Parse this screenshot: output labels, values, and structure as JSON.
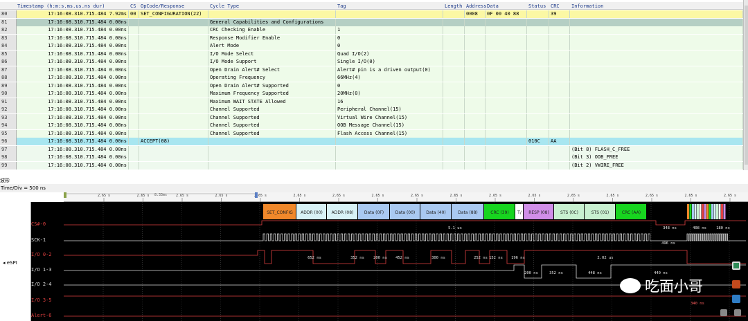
{
  "table": {
    "columns": [
      "Timestamp (h:m:s.ms.us.ns dur)",
      "CS",
      "OpCode/Response",
      "Cycle Type",
      "Tag",
      "Length",
      "Address",
      "Data",
      "Status",
      "CRC",
      "Information"
    ],
    "rows": [
      {
        "idx": "80",
        "ts": "17:16:08.310.715.484 7.92ms",
        "cs": "00",
        "op": "SET_CONFIGURATION(22)",
        "cycle": "",
        "tag": "",
        "len": "",
        "addr": "0008",
        "data": "0F 00 40 88",
        "status": "",
        "crc": "39",
        "info": "",
        "style": "y"
      },
      {
        "idx": "81",
        "ts": "17:16:08.310.715.484 0.00ns",
        "cs": "",
        "op": "",
        "cycle": "General Capabilities and Configurations",
        "tag": "",
        "len": "",
        "addr": "",
        "data": "",
        "status": "",
        "crc": "",
        "info": "",
        "style": "g"
      },
      {
        "idx": "82",
        "ts": "17:16:08.310.715.484 0.00ns",
        "cs": "",
        "op": "",
        "cycle": "CRC Checking Enable",
        "tag": "1",
        "len": "",
        "addr": "",
        "data": "",
        "status": "",
        "crc": "",
        "info": "",
        "style": ""
      },
      {
        "idx": "83",
        "ts": "17:16:08.310.715.484 0.00ns",
        "cs": "",
        "op": "",
        "cycle": "Response Modifier Enable",
        "tag": "0",
        "len": "",
        "addr": "",
        "data": "",
        "status": "",
        "crc": "",
        "info": "",
        "style": ""
      },
      {
        "idx": "84",
        "ts": "17:16:08.310.715.484 0.00ns",
        "cs": "",
        "op": "",
        "cycle": "Alert Mode",
        "tag": "0",
        "len": "",
        "addr": "",
        "data": "",
        "status": "",
        "crc": "",
        "info": "",
        "style": ""
      },
      {
        "idx": "85",
        "ts": "17:16:08.310.715.484 0.00ns",
        "cs": "",
        "op": "",
        "cycle": "I/O Mode Select",
        "tag": "Quad I/O(2)",
        "len": "",
        "addr": "",
        "data": "",
        "status": "",
        "crc": "",
        "info": "",
        "style": ""
      },
      {
        "idx": "86",
        "ts": "17:16:08.310.715.484 0.00ns",
        "cs": "",
        "op": "",
        "cycle": "I/O Mode Support",
        "tag": "Single I/O(0)",
        "len": "",
        "addr": "",
        "data": "",
        "status": "",
        "crc": "",
        "info": "",
        "style": ""
      },
      {
        "idx": "87",
        "ts": "17:16:08.310.715.484 0.00ns",
        "cs": "",
        "op": "",
        "cycle": "Open Drain Alert# Select",
        "tag": "Alert# pin is a driven output(0)",
        "len": "",
        "addr": "",
        "data": "",
        "status": "",
        "crc": "",
        "info": "",
        "style": ""
      },
      {
        "idx": "88",
        "ts": "17:16:08.310.715.484 0.00ns",
        "cs": "",
        "op": "",
        "cycle": "Operating Frequency",
        "tag": "66MHz(4)",
        "len": "",
        "addr": "",
        "data": "",
        "status": "",
        "crc": "",
        "info": "",
        "style": ""
      },
      {
        "idx": "89",
        "ts": "17:16:08.310.715.484 0.00ns",
        "cs": "",
        "op": "",
        "cycle": "Open Drain Alert# Supported",
        "tag": "0",
        "len": "",
        "addr": "",
        "data": "",
        "status": "",
        "crc": "",
        "info": "",
        "style": ""
      },
      {
        "idx": "90",
        "ts": "17:16:08.310.715.484 0.00ns",
        "cs": "",
        "op": "",
        "cycle": "Maximum Frequency Supported",
        "tag": "20MHz(0)",
        "len": "",
        "addr": "",
        "data": "",
        "status": "",
        "crc": "",
        "info": "",
        "style": ""
      },
      {
        "idx": "91",
        "ts": "17:16:08.310.715.484 0.00ns",
        "cs": "",
        "op": "",
        "cycle": "Maximum WAIT STATE Allowed",
        "tag": "16",
        "len": "",
        "addr": "",
        "data": "",
        "status": "",
        "crc": "",
        "info": "",
        "style": ""
      },
      {
        "idx": "92",
        "ts": "17:16:08.310.715.484 0.00ns",
        "cs": "",
        "op": "",
        "cycle": "Channel Supported",
        "tag": "Peripheral Channel(15)",
        "len": "",
        "addr": "",
        "data": "",
        "status": "",
        "crc": "",
        "info": "",
        "style": ""
      },
      {
        "idx": "93",
        "ts": "17:16:08.310.715.484 0.00ns",
        "cs": "",
        "op": "",
        "cycle": "Channel Supported",
        "tag": "Virtual Wire Channel(15)",
        "len": "",
        "addr": "",
        "data": "",
        "status": "",
        "crc": "",
        "info": "",
        "style": ""
      },
      {
        "idx": "94",
        "ts": "17:16:08.310.715.484 0.00ns",
        "cs": "",
        "op": "",
        "cycle": "Channel Supported",
        "tag": "OOB Message Channel(15)",
        "len": "",
        "addr": "",
        "data": "",
        "status": "",
        "crc": "",
        "info": "",
        "style": ""
      },
      {
        "idx": "95",
        "ts": "17:16:08.310.715.484 0.00ns",
        "cs": "",
        "op": "",
        "cycle": "Channel Supported",
        "tag": "Flash Access Channel(15)",
        "len": "",
        "addr": "",
        "data": "",
        "status": "",
        "crc": "",
        "info": "",
        "style": ""
      },
      {
        "idx": "96",
        "ts": "17:16:08.310.715.484 0.00ns",
        "cs": "",
        "op": "ACCEPT(08)",
        "cycle": "",
        "tag": "",
        "len": "",
        "addr": "",
        "data": "",
        "status": "010C",
        "crc": "AA",
        "info": "",
        "style": "c"
      },
      {
        "idx": "97",
        "ts": "17:16:08.310.715.484 0.00ns",
        "cs": "",
        "op": "",
        "cycle": "",
        "tag": "",
        "len": "",
        "addr": "",
        "data": "",
        "status": "",
        "crc": "",
        "info": "(Bit 8) FLASH_C_FREE",
        "style": "w"
      },
      {
        "idx": "98",
        "ts": "17:16:08.310.715.484 0.00ns",
        "cs": "",
        "op": "",
        "cycle": "",
        "tag": "",
        "len": "",
        "addr": "",
        "data": "",
        "status": "",
        "crc": "",
        "info": "(Bit 3) OOB_FREE",
        "style": "w"
      },
      {
        "idx": "99",
        "ts": "17:16:08.310.715.484 0.00ns",
        "cs": "",
        "op": "",
        "cycle": "",
        "tag": "",
        "len": "",
        "addr": "",
        "data": "",
        "status": "",
        "crc": "",
        "info": "(Bit 2) VWIRE_FREE",
        "style": "w"
      }
    ]
  },
  "waveform": {
    "title": "波形",
    "time_div": "Time/Div = 500 ns",
    "cursor_delta": "8.33ms",
    "ruler_ticks": [
      "2.65 s",
      "2.65 s",
      "2.65 s",
      "2.65 s",
      "2.65 s",
      "2.65 s",
      "2.65 s",
      "2.65 s",
      "2.65 s",
      "2.65 s",
      "2.65 s",
      "2.65 s",
      "2.65 s",
      "2.65 s",
      "2.65 s",
      "2.65 s",
      "2.65 s"
    ],
    "group_label": "eSPI",
    "signals": [
      {
        "name": "CS#-0",
        "color": "red"
      },
      {
        "name": "SCK-1",
        "color": "white"
      },
      {
        "name": "I/O 0-2",
        "color": "red"
      },
      {
        "name": "I/O 1-3",
        "color": "white"
      },
      {
        "name": "I/O 2-4",
        "color": "white"
      },
      {
        "name": "I/O 3-5",
        "color": "red"
      },
      {
        "name": "Alert-6",
        "color": "red"
      }
    ],
    "packets": [
      {
        "label": "SET_CONFIG",
        "color": "#f0882a"
      },
      {
        "label": "ADDR (00)",
        "color": "#d8f2f6"
      },
      {
        "label": "ADDR (08)",
        "color": "#d8f2f6"
      },
      {
        "label": "Data (0F)",
        "color": "#a9c9f1"
      },
      {
        "label": "Data (00)",
        "color": "#a9c9f1"
      },
      {
        "label": "Data (40)",
        "color": "#a9c9f1"
      },
      {
        "label": "Data (88)",
        "color": "#a9c9f1"
      },
      {
        "label": "CRC (39)",
        "color": "#17d51f"
      },
      {
        "label": "T/",
        "color": "#ffffff"
      },
      {
        "label": "RESP (08)",
        "color": "#d08ee8"
      },
      {
        "label": "STS (0C)",
        "color": "#c8f0d0"
      },
      {
        "label": "STS (01)",
        "color": "#c8f0d0"
      },
      {
        "label": "CRC (AA)",
        "color": "#17d51f"
      }
    ],
    "annotations": {
      "cs": [
        "5.1 us",
        "348 ns",
        "408 ns",
        "180 ns"
      ],
      "sck": [
        "496 ns"
      ],
      "io0": [
        "652 ns",
        "352 ns",
        "200 ns",
        "452 ns",
        "300 ns",
        "252 ns",
        "152 ns",
        "196 ns",
        "2.02 us"
      ],
      "io1": [
        "200 ns",
        "352 ns",
        "448 ns",
        "440 ns"
      ],
      "io3": [
        "340 ns"
      ]
    }
  },
  "watermark": {
    "text": "吃面小哥"
  }
}
